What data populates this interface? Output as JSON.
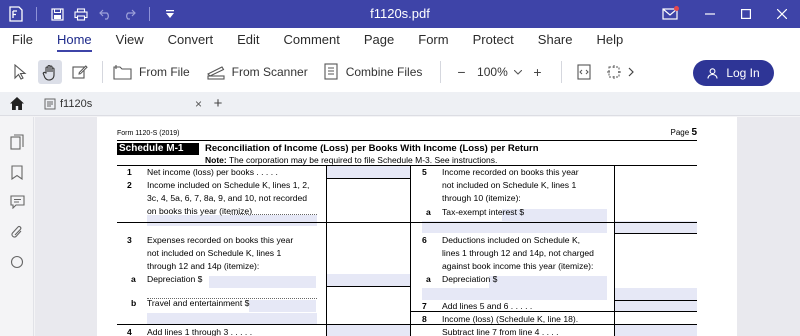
{
  "window": {
    "title": "f1120s.pdf"
  },
  "menu": [
    "File",
    "Home",
    "View",
    "Convert",
    "Edit",
    "Comment",
    "Page",
    "Form",
    "Protect",
    "Share",
    "Help"
  ],
  "active_menu": "Home",
  "toolbar": {
    "from_file": "From File",
    "from_scanner": "From Scanner",
    "combine_files": "Combine Files",
    "zoom": "100%",
    "login": "Log In"
  },
  "tab": {
    "name": "f1120s"
  },
  "form": {
    "id": "Form 1120-S (2019)",
    "page_label": "Page",
    "page_num": "5",
    "schedule": "Schedule M-1",
    "title": "Reconciliation of Income (Loss) per Books With Income (Loss) per Return",
    "note_bold": "Note:",
    "note": "The corporation may be required to file Schedule M-3. See instructions.",
    "left": {
      "l1_num": "1",
      "l1": "Net income (loss) per books . . . . .",
      "l2_num": "2",
      "l2a": "Income included on Schedule K, lines 1, 2,",
      "l2b": "3c, 4, 5a, 6, 7, 8a, 9, and 10, not recorded",
      "l2c": "on books this year (itemize)",
      "l3_num": "3",
      "l3a": "Expenses recorded on books this year",
      "l3b": "not included on Schedule K, lines 1",
      "l3c": "through 12 and 14p (itemize):",
      "l3a_sub": "a",
      "l3a_txt": "Depreciation $",
      "l3b_sub": "b",
      "l3b_txt": "Travel and entertainment $",
      "l4_num": "4",
      "l4": "Add lines 1 through 3 . . . . ."
    },
    "right": {
      "l5_num": "5",
      "l5a": "Income recorded on books this year",
      "l5b": "not included on Schedule K, lines 1",
      "l5c": "through 10 (itemize):",
      "l5a_sub": "a",
      "l5a_txt": "Tax-exempt interest $",
      "l6_num": "6",
      "l6a": "Deductions included on Schedule K,",
      "l6b": "lines 1 through 12 and 14p, not charged",
      "l6c": "against book income this year (itemize):",
      "l6a_sub": "a",
      "l6a_txt": "Depreciation $",
      "l7_num": "7",
      "l7": "Add lines 5 and 6 . . . . .",
      "l8_num": "8",
      "l8a": "Income (loss) (Schedule K, line 18).",
      "l8b": "Subtract line 7 from line 4 . . . ."
    }
  }
}
